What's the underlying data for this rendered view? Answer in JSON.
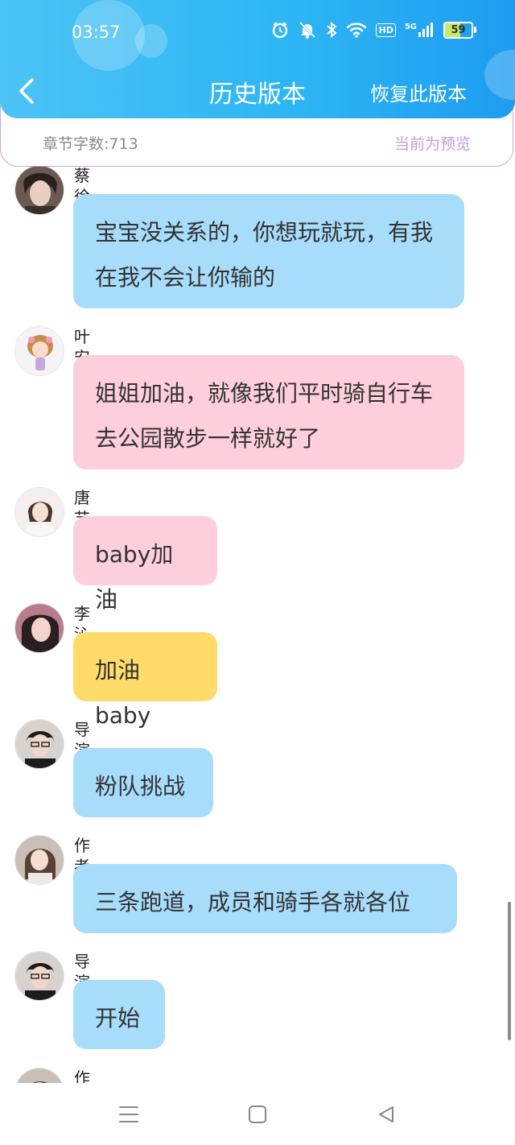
{
  "status_bar": {
    "time": "03:57",
    "icons": [
      "alarm-icon",
      "mute-icon",
      "bluetooth-icon",
      "wifi-icon",
      "hd-icon",
      "5g-signal-icon",
      "battery-icon"
    ],
    "hd_label": "HD",
    "network_label": "5G",
    "battery_level": "59"
  },
  "header": {
    "title": "历史版本",
    "back_icon": "chevron-left-icon",
    "restore_label": "恢复此版本"
  },
  "info_bar": {
    "word_count": "章节字数:713",
    "preview_label": "当前为预览"
  },
  "messages": [
    {
      "sender": "蔡徐坤",
      "text": "宝宝没关系的，你想玩就玩，有我在我不会让你输的",
      "color": "blue"
    },
    {
      "sender": "叶安琪",
      "text": "姐姐加油，就像我们平时骑自行车去公园散步一样就好了",
      "color": "pink"
    },
    {
      "sender": "唐艺昕",
      "text": "baby加油",
      "color": "pink"
    },
    {
      "sender": "李沁",
      "text": "加油baby",
      "color": "yellow"
    },
    {
      "sender": "导演",
      "text": "粉队挑战",
      "color": "blue"
    },
    {
      "sender": "作者",
      "text": "三条跑道，成员和骑手各就各位",
      "color": "blue"
    },
    {
      "sender": "导演",
      "text": "开始",
      "color": "blue"
    },
    {
      "sender": "作者",
      "text": "",
      "color": "blue"
    }
  ],
  "colors": {
    "header_gradient_start": "#4cc3f5",
    "header_gradient_end": "#1e9cf0",
    "bubble_blue": "#a8dcfb",
    "bubble_pink": "#fdcfdd",
    "bubble_yellow": "#fedb6a",
    "info_border": "#c9a6e3",
    "preview_text": "#c49cdc"
  },
  "nav_bar": {
    "buttons": [
      "menu-icon",
      "home-icon",
      "back-triangle-icon"
    ]
  }
}
